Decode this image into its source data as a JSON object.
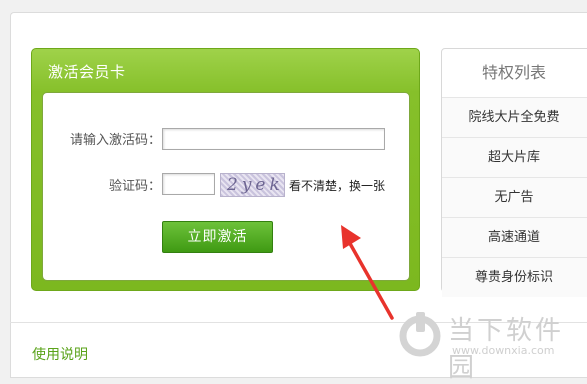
{
  "card": {
    "title": "激活会员卡",
    "code_label": "请输入激活码：",
    "code_value": "",
    "captcha_label": "验证码：",
    "captcha_value": "",
    "captcha_text": "2yek",
    "refresh_link": "看不清楚，换一张",
    "activate_button": "立即激活"
  },
  "privileges": {
    "title": "特权列表",
    "items": [
      "院线大片全免费",
      "超大片库",
      "无广告",
      "高速通道",
      "尊贵身份标识"
    ]
  },
  "footer": {
    "usage_link": "使用说明"
  },
  "watermark": {
    "text": "当下软件园",
    "url": "www.downxia.com"
  },
  "colors": {
    "card_green": "#86c02a",
    "button_green": "#4fa61f",
    "link_green": "#5aa31a",
    "arrow_red": "#e8332c"
  }
}
